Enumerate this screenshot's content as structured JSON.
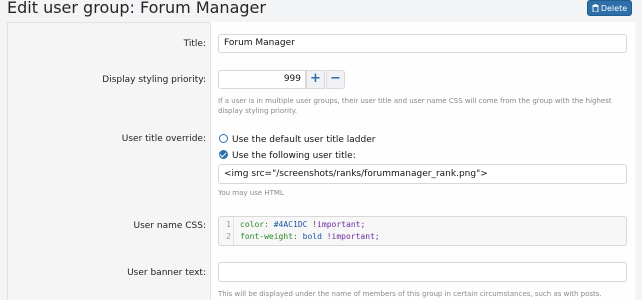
{
  "header": {
    "title": "Edit user group: Forum Manager",
    "delete_label": "Delete",
    "delete_icon": "trash-icon"
  },
  "colors": {
    "accent": "#2d6fa8",
    "panel_bg": "#f5f5f5",
    "hint_text": "#8a8a8a",
    "code_key": "#2a8a2a",
    "code_value": "#1b58a6"
  },
  "form": {
    "title": {
      "label": "Title:",
      "value": "Forum Manager"
    },
    "priority": {
      "label": "Display styling priority:",
      "value": "999",
      "plus": "+",
      "minus": "−",
      "hint": "If a user is in multiple user groups, their user title and user name CSS will come from the group with the highest display styling priority."
    },
    "user_title": {
      "label": "User title override:",
      "option_default": "Use the default user title ladder",
      "option_custom": "Use the following user title:",
      "selected": "custom",
      "value": "<img src=\"/screenshots/ranks/forummanager_rank.png\">",
      "hint": "You may use HTML"
    },
    "username_css": {
      "label": "User name CSS:",
      "lines": [
        {
          "num": "1",
          "prop": "color:",
          "value": "#4AC1DC",
          "flag": "!important;"
        },
        {
          "num": "2",
          "prop": "font-weight:",
          "value": "bold",
          "flag": "!important;"
        }
      ]
    },
    "banner": {
      "label": "User banner text:",
      "value": "",
      "hint": "This will be displayed under the name of members of this group in certain circumstances, such as with posts."
    }
  }
}
